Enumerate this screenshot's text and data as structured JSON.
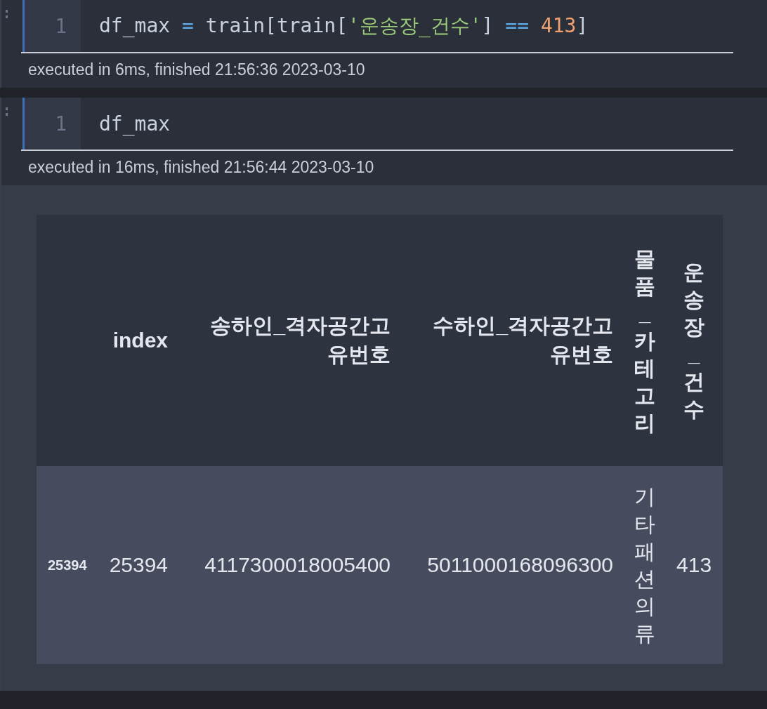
{
  "cells": [
    {
      "line_number": "1",
      "code": [
        {
          "kind": "name",
          "text": "df_max "
        },
        {
          "kind": "operator",
          "text": "="
        },
        {
          "kind": "name",
          "text": " train[train["
        },
        {
          "kind": "string",
          "text": "'운송장_건수'"
        },
        {
          "kind": "name",
          "text": "] "
        },
        {
          "kind": "operator",
          "text": "== "
        },
        {
          "kind": "number",
          "text": "413"
        },
        {
          "kind": "name",
          "text": "]"
        }
      ],
      "execution": "executed in 6ms, finished 21:56:36 2023-03-10"
    },
    {
      "line_number": "1",
      "code": [
        {
          "kind": "name",
          "text": "df_max"
        }
      ],
      "execution": "executed in 16ms, finished 21:56:44 2023-03-10",
      "output": {
        "columns": [
          {
            "kind": "horizontal"
          },
          {
            "label": "index",
            "kind": "horizontal"
          },
          {
            "label": "송하인_격자공간고유번호",
            "kind": "horizontal"
          },
          {
            "label": "수하인_격자공간고유번호",
            "kind": "horizontal"
          },
          {
            "label": "물품_카테고리",
            "kind": "vertical"
          },
          {
            "label": "운송장_건수",
            "kind": "vertical"
          }
        ],
        "rows": [
          {
            "index": "25394",
            "values": [
              {
                "text": "25394",
                "kind": "horizontal"
              },
              {
                "text": "4117300018005400",
                "kind": "horizontal"
              },
              {
                "text": "5011000168096300",
                "kind": "horizontal"
              },
              {
                "text": "기타패션의류",
                "kind": "vertical"
              },
              {
                "text": "413",
                "kind": "horizontal"
              }
            ]
          }
        ]
      }
    }
  ]
}
